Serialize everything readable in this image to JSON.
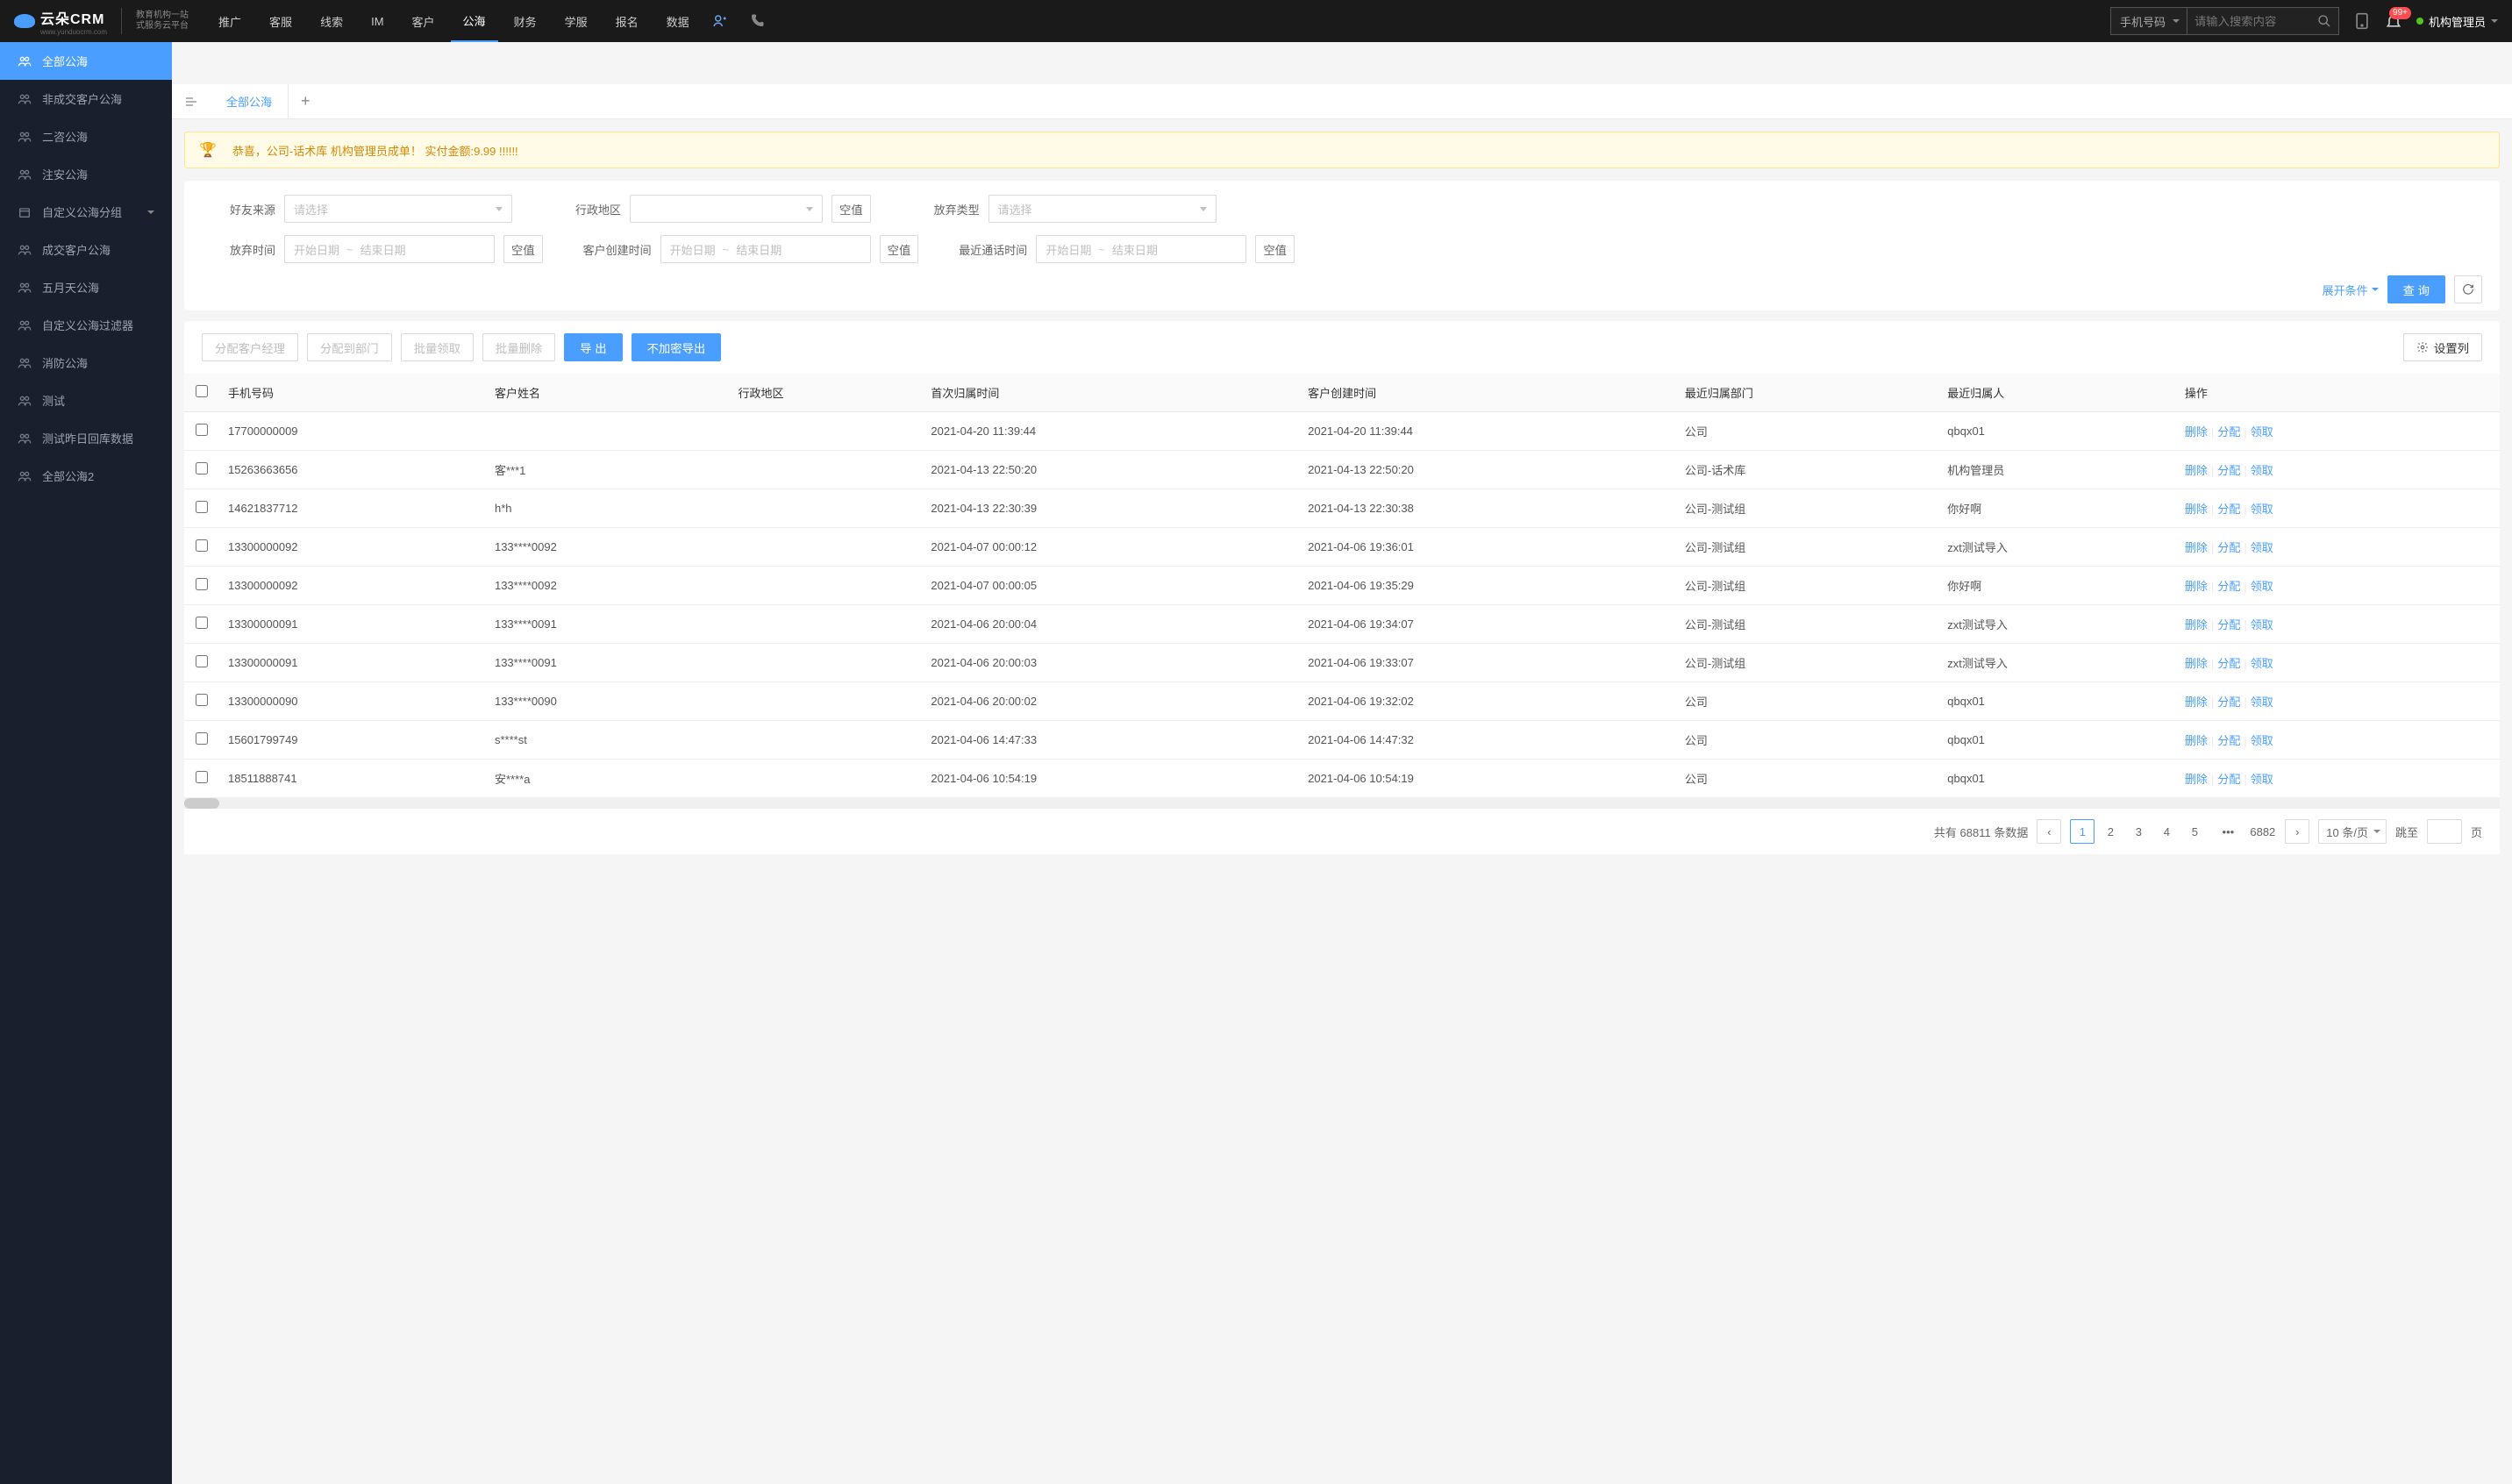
{
  "header": {
    "logo_text": "云朵CRM",
    "logo_url": "www.yunduocrm.com",
    "logo_sub1": "教育机构一站",
    "logo_sub2": "式服务云平台",
    "nav": [
      "推广",
      "客服",
      "线索",
      "IM",
      "客户",
      "公海",
      "财务",
      "学服",
      "报名",
      "数据"
    ],
    "nav_active": 5,
    "search_type": "手机号码",
    "search_placeholder": "请输入搜索内容",
    "badge": "99+",
    "user_name": "机构管理员"
  },
  "sidebar": {
    "items": [
      {
        "label": "全部公海",
        "icon": "people"
      },
      {
        "label": "非成交客户公海",
        "icon": "people"
      },
      {
        "label": "二咨公海",
        "icon": "people"
      },
      {
        "label": "注安公海",
        "icon": "people"
      },
      {
        "label": "自定义公海分组",
        "icon": "box",
        "expandable": true
      },
      {
        "label": "成交客户公海",
        "icon": "people"
      },
      {
        "label": "五月天公海",
        "icon": "people"
      },
      {
        "label": "自定义公海过滤器",
        "icon": "people"
      },
      {
        "label": "消防公海",
        "icon": "people"
      },
      {
        "label": "测试",
        "icon": "people"
      },
      {
        "label": "测试昨日回库数据",
        "icon": "people"
      },
      {
        "label": "全部公海2",
        "icon": "people"
      }
    ],
    "active": 0
  },
  "tabs": {
    "items": [
      "全部公海"
    ],
    "active": 0
  },
  "banner": "恭喜，公司-话术库  机构管理员成单！  实付金额:9.99 !!!!!!",
  "filters": {
    "source_label": "好友来源",
    "source_placeholder": "请选择",
    "region_label": "行政地区",
    "abandon_type_label": "放弃类型",
    "abandon_type_placeholder": "请选择",
    "abandon_time_label": "放弃时间",
    "create_time_label": "客户创建时间",
    "last_call_label": "最近通话时间",
    "date_start": "开始日期",
    "date_end": "结束日期",
    "null_btn": "空值",
    "expand": "展开条件",
    "query": "查 询"
  },
  "toolbar": {
    "assign_manager": "分配客户经理",
    "assign_dept": "分配到部门",
    "batch_claim": "批量领取",
    "batch_delete": "批量删除",
    "export": "导 出",
    "export_plain": "不加密导出",
    "set_columns": "设置列"
  },
  "table": {
    "headers": [
      "手机号码",
      "客户姓名",
      "行政地区",
      "首次归属时间",
      "客户创建时间",
      "最近归属部门",
      "最近归属人",
      "操作"
    ],
    "actions": {
      "delete": "删除",
      "assign": "分配",
      "claim": "领取"
    },
    "rows": [
      {
        "phone": "17700000009",
        "name": "",
        "region": "",
        "first_time": "2021-04-20 11:39:44",
        "create_time": "2021-04-20 11:39:44",
        "dept": "公司",
        "owner": "qbqx01"
      },
      {
        "phone": "15263663656",
        "name": "客***1",
        "region": "",
        "first_time": "2021-04-13 22:50:20",
        "create_time": "2021-04-13 22:50:20",
        "dept": "公司-话术库",
        "owner": "机构管理员"
      },
      {
        "phone": "14621837712",
        "name": "h*h",
        "region": "",
        "first_time": "2021-04-13 22:30:39",
        "create_time": "2021-04-13 22:30:38",
        "dept": "公司-测试组",
        "owner": "你好啊"
      },
      {
        "phone": "13300000092",
        "name": "133****0092",
        "region": "",
        "first_time": "2021-04-07 00:00:12",
        "create_time": "2021-04-06 19:36:01",
        "dept": "公司-测试组",
        "owner": "zxt测试导入"
      },
      {
        "phone": "13300000092",
        "name": "133****0092",
        "region": "",
        "first_time": "2021-04-07 00:00:05",
        "create_time": "2021-04-06 19:35:29",
        "dept": "公司-测试组",
        "owner": "你好啊"
      },
      {
        "phone": "13300000091",
        "name": "133****0091",
        "region": "",
        "first_time": "2021-04-06 20:00:04",
        "create_time": "2021-04-06 19:34:07",
        "dept": "公司-测试组",
        "owner": "zxt测试导入"
      },
      {
        "phone": "13300000091",
        "name": "133****0091",
        "region": "",
        "first_time": "2021-04-06 20:00:03",
        "create_time": "2021-04-06 19:33:07",
        "dept": "公司-测试组",
        "owner": "zxt测试导入"
      },
      {
        "phone": "13300000090",
        "name": "133****0090",
        "region": "",
        "first_time": "2021-04-06 20:00:02",
        "create_time": "2021-04-06 19:32:02",
        "dept": "公司",
        "owner": "qbqx01"
      },
      {
        "phone": "15601799749",
        "name": "s****st",
        "region": "",
        "first_time": "2021-04-06 14:47:33",
        "create_time": "2021-04-06 14:47:32",
        "dept": "公司",
        "owner": "qbqx01"
      },
      {
        "phone": "18511888741",
        "name": "安****a",
        "region": "",
        "first_time": "2021-04-06 10:54:19",
        "create_time": "2021-04-06 10:54:19",
        "dept": "公司",
        "owner": "qbqx01"
      }
    ]
  },
  "pagination": {
    "total_prefix": "共有",
    "total": "68811",
    "total_suffix": "条数据",
    "pages": [
      "1",
      "2",
      "3",
      "4",
      "5"
    ],
    "ellipsis": "•••",
    "last_page": "6882",
    "page_size": "10 条/页",
    "jump_label": "跳至",
    "page_suffix": "页"
  }
}
